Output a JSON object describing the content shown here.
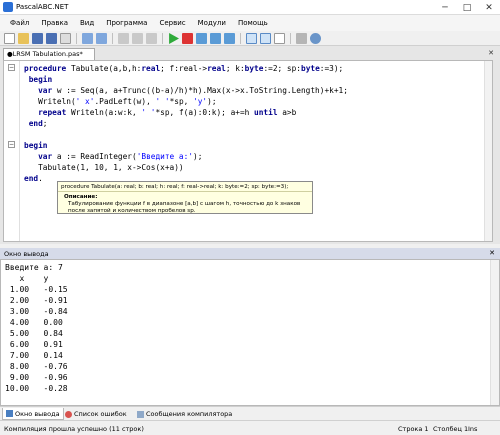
{
  "window": {
    "title": "PascalABC.NET",
    "min": "─",
    "max": "□",
    "close": "✕"
  },
  "menu": [
    "Файл",
    "Правка",
    "Вид",
    "Программа",
    "Сервис",
    "Модули",
    "Помощь"
  ],
  "toolbar_icons": [
    "new-file-icon",
    "open-icon",
    "save-icon",
    "save-all-icon",
    "close-icon",
    "undo-icon",
    "redo-icon",
    "cut-icon",
    "copy-icon",
    "paste-icon",
    "run-icon",
    "stop-icon",
    "debug-icon",
    "step-icon",
    "step-over-icon",
    "step-out-icon",
    "layout-icon",
    "layout2-icon",
    "layout3-icon",
    "format-icon",
    "help-icon"
  ],
  "tab": {
    "label": "●LRSM Tabulation.pas*",
    "close": "✕"
  },
  "code": {
    "line1": {
      "kw": "procedure",
      "rest": " Tabulate(a,b,h:",
      "kw2": "real",
      "rest2": "; f:real->",
      "kw3": "real",
      "rest3": "; k:",
      "kw4": "byte",
      "rest4": ":=2; sp:",
      "kw5": "byte",
      "rest5": ":=3);"
    },
    "line2": {
      "kw": "begin"
    },
    "line3": {
      "kw": "var",
      "rest": " w := Seq(a, a+Trunc((b-a)/h)*h).Max(x->x.ToString.Length)+k+1;"
    },
    "line4": {
      "pre": "Writeln(",
      "s1": "' x'",
      "mid": ".PadLeft(w), ",
      "s2": "' '",
      "mid2": "*sp, ",
      "s3": "'y'",
      "post": ");"
    },
    "line5": {
      "kw": "repeat",
      "mid": " Writeln(a:w:k, ",
      "s1": "' '",
      "mid2": "*sp, f(a):0:k); a+=h ",
      "kw2": "until",
      "post": " a>b"
    },
    "line6": {
      "kw": "end",
      "post": ";"
    },
    "line7": {
      "kw": "begin"
    },
    "line8": {
      "kw": "var",
      "mid": " a := ReadInteger(",
      "s1": "'Введите a:'",
      "post": ");"
    },
    "line9": {
      "text": "Tabulate(1, 10, 1, x->Cos(x+a))"
    },
    "line10": {
      "kw": "end",
      "post": "."
    }
  },
  "tooltip": {
    "signature": "procedure Tabulate(a: real; b: real; h: real; f: real->real; k: byte:=2; sp: byte:=3);",
    "label": "Описание:",
    "description": "Табулирование функции f в диапазоне [a,b] с шагом h, точностью до k знаков после запятой и количеством пробелов sp."
  },
  "output_panel": {
    "title": "Окно вывода",
    "close": "✕",
    "lines": [
      "Введите a: 7",
      "   x    y",
      " 1.00   -0.15",
      " 2.00   -0.91",
      " 3.00   -0.84",
      " 4.00   0.00",
      " 5.00   0.84",
      " 6.00   0.91",
      " 7.00   0.14",
      " 8.00   -0.76",
      " 9.00   -0.96",
      "10.00   -0.28"
    ]
  },
  "bottom_tabs": [
    "Окно вывода",
    "Список ошибок",
    "Сообщения компилятора"
  ],
  "status": {
    "message": "Компиляция прошла успешно (11 строк)",
    "line": "Строка  1",
    "col": "Столбец  1",
    "mode": "Ins"
  },
  "colors": {
    "keyword": "#00008b",
    "string": "#0000ff",
    "tooltip_bg": "#ffffe1",
    "panel_header": "#d6dbe9"
  }
}
